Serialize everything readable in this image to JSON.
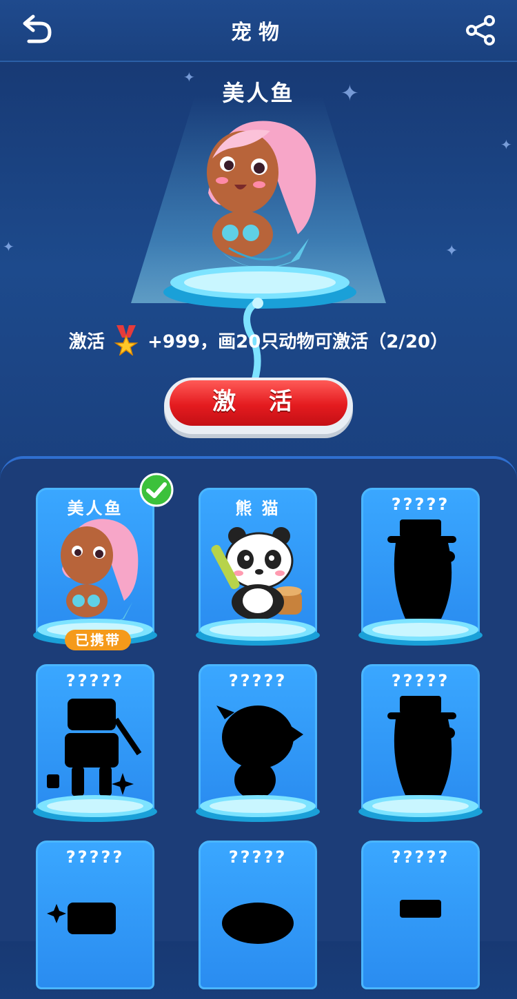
{
  "header": {
    "title": "宠物"
  },
  "featured": {
    "name": "美人鱼"
  },
  "activate": {
    "prefix": "激活",
    "reward": "+999，画20只动物可激活（2/20）",
    "button_label": "激 活"
  },
  "pets": [
    {
      "label": "美人鱼",
      "badge": "已携带",
      "selected": true
    },
    {
      "label": "熊 猫"
    },
    {
      "label": "?????"
    },
    {
      "label": "?????"
    },
    {
      "label": "?????"
    },
    {
      "label": "?????"
    },
    {
      "label": "?????"
    },
    {
      "label": "?????"
    },
    {
      "label": "?????"
    }
  ],
  "colors": {
    "accent": "#2a8cf0",
    "button": "#e41b1f",
    "badge": "#f59a1a",
    "check": "#3cc13b"
  },
  "icons": {
    "back": "back-arrow-icon",
    "share": "share-icon",
    "medal": "medal-icon",
    "check": "check-icon"
  }
}
